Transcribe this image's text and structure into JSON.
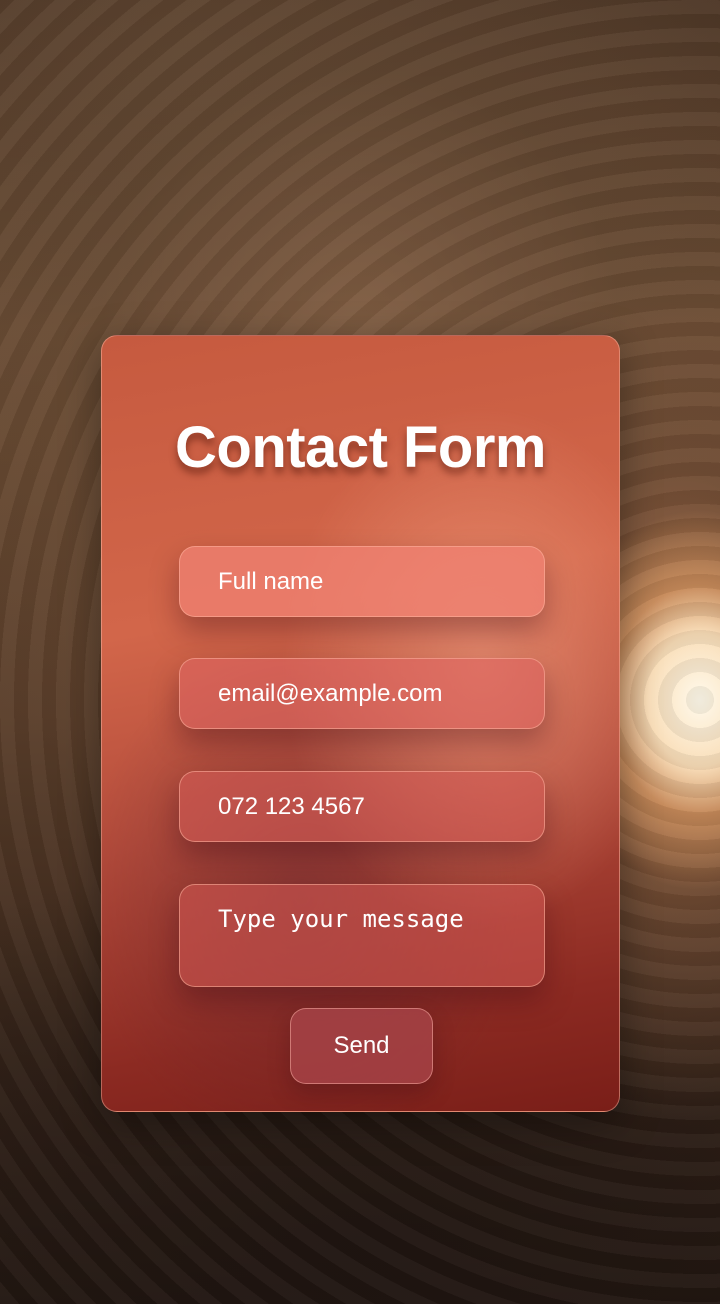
{
  "form": {
    "title": "Contact Form",
    "name_placeholder": "Full name",
    "email_placeholder": "email@example.com",
    "phone_placeholder": "072 123 4567",
    "message_placeholder": "Type your message",
    "send_label": "Send"
  },
  "colors": {
    "card": "#c65a3f",
    "text": "#ffffff"
  }
}
